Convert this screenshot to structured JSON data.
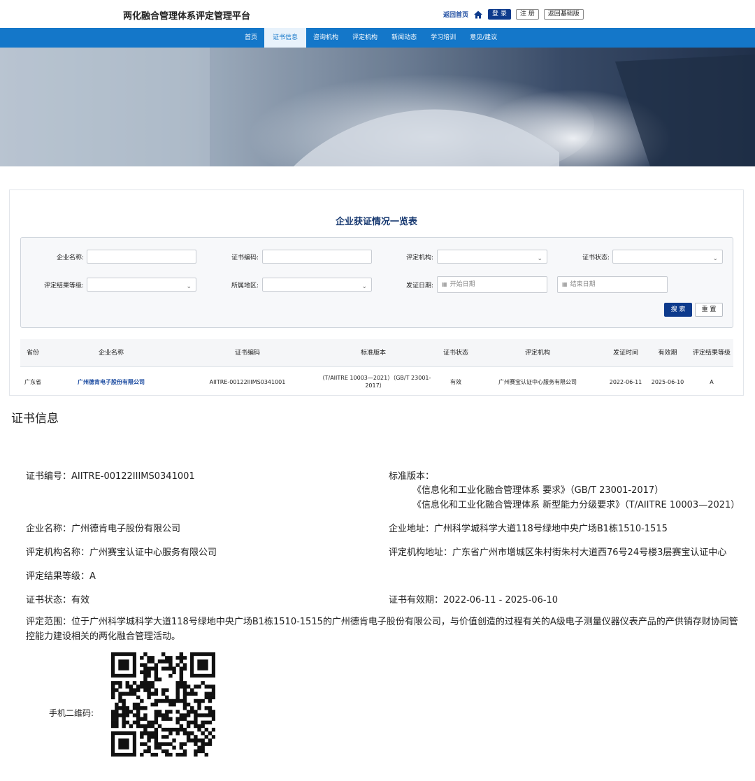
{
  "header": {
    "site_title": "两化融合管理体系评定管理平台",
    "home_link": "返回首页",
    "login": "登 录",
    "register": "注 册",
    "back_base": "返回基础版"
  },
  "nav": {
    "items": [
      "首页",
      "证书信息",
      "咨询机构",
      "评定机构",
      "新闻动态",
      "学习培训",
      "意见/建议"
    ],
    "active_index": 1
  },
  "panel": {
    "title": "企业获证情况一览表",
    "filters": {
      "company_name_label": "企业名称:",
      "cert_no_label": "证书编码:",
      "org_label": "评定机构:",
      "status_label": "证书状态:",
      "grade_label": "评定结果等级:",
      "region_label": "所属地区:",
      "issue_date_label": "发证日期:",
      "start_date_placeholder": "开始日期",
      "end_date_placeholder": "结束日期"
    },
    "search_button": "搜 索",
    "reset_button": "重 置",
    "table": {
      "headers": [
        "省份",
        "企业名称",
        "证书编码",
        "标准版本",
        "证书状态",
        "评定机构",
        "发证时间",
        "有效期",
        "评定结果等级"
      ],
      "row": {
        "province": "广东省",
        "company": "广州德肯电子股份有限公司",
        "cert_no": "AIITRE-00122IIIMS0341001",
        "standard": "（T/AIITRE 10003—2021）（GB/T 23001-2017）",
        "status": "有效",
        "org": "广州赛宝认证中心服务有限公司",
        "issue_date": "2022-06-11",
        "expiry": "2025-06-10",
        "grade": "A"
      }
    }
  },
  "cert": {
    "heading": "证书信息",
    "cert_no": "证书编号：AIITRE-00122IIIMS0341001",
    "standard_label": "标准版本：",
    "standard_line1": "《信息化和工业化融合管理体系 要求》（GB/T 23001-2017）",
    "standard_line2": "《信息化和工业化融合管理体系 新型能力分级要求》（T/AIITRE 10003—2021）",
    "company": "企业名称：广州德肯电子股份有限公司",
    "address": "企业地址：广州科学城科学大道118号绿地中央广场B1栋1510-1515",
    "org_name": "评定机构名称：广州赛宝认证中心服务有限公司",
    "org_address": "评定机构地址：广东省广州市增城区朱村街朱村大道西76号24号楼3层赛宝认证中心",
    "grade": "评定结果等级：A",
    "status": "证书状态：有效",
    "validity": "证书有效期：2022-06-11 - 2025-06-10",
    "scope": "评定范围：位于广州科学城科学大道118号绿地中央广场B1栋1510-1515的广州德肯电子股份有限公司，与价值创造的过程有关的A级电子测量仪器仪表产品的产供销存财协同管控能力建设相关的两化融合管理活动。",
    "qr_label": "手机二维码:"
  },
  "colors": {
    "nav_blue": "#1477c9",
    "brand_dark_blue": "#0d3a8c",
    "link_blue": "#1a4aa0",
    "title_blue": "#15376f"
  },
  "icons": {
    "home": "home-icon",
    "dropdown": "chevron-down-icon",
    "calendar": "calendar-icon",
    "qr": "qr-code-icon"
  }
}
